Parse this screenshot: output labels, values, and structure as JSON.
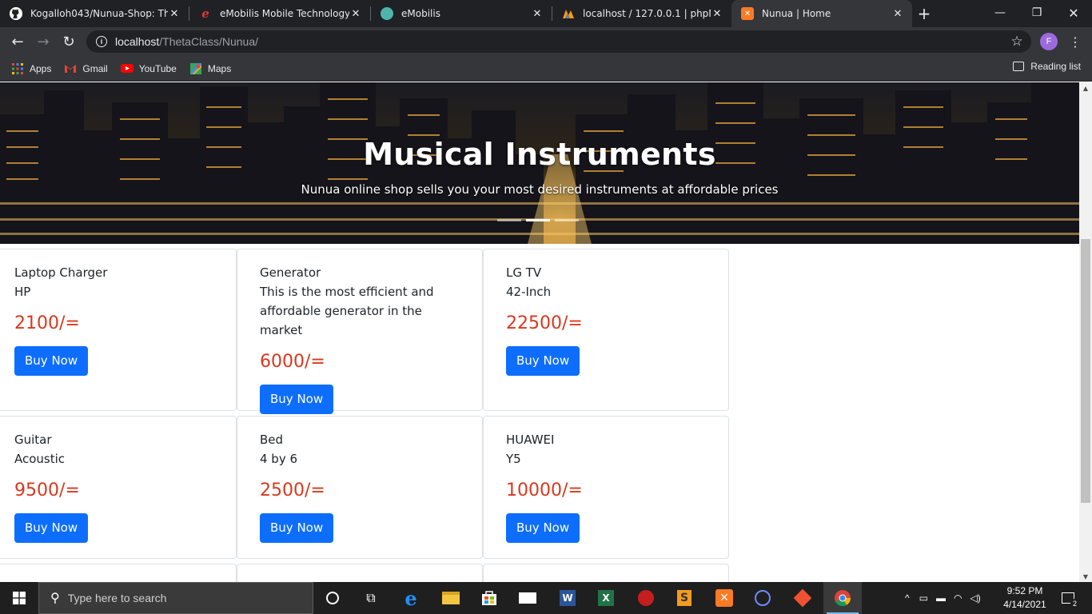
{
  "browser": {
    "tabs": [
      {
        "title": "Kogalloh043/Nunua-Shop: Thi",
        "icon": "github-icon"
      },
      {
        "title": "eMobilis Mobile Technology In",
        "icon": "emobilis-e-icon"
      },
      {
        "title": "eMobilis",
        "icon": "emobilis-globe-icon"
      },
      {
        "title": "localhost / 127.0.0.1 | phpMyA",
        "icon": "phpmyadmin-icon"
      },
      {
        "title": "Nunua | Home",
        "icon": "xampp-icon"
      }
    ],
    "address": {
      "host": "localhost",
      "path": "/ThetaClass/Nunua/"
    },
    "profile_initial": "F",
    "bookmarks": [
      {
        "label": "Apps",
        "icon": "apps-grid-icon"
      },
      {
        "label": "Gmail",
        "icon": "gmail-icon"
      },
      {
        "label": "YouTube",
        "icon": "youtube-icon"
      },
      {
        "label": "Maps",
        "icon": "maps-icon"
      }
    ],
    "reading_list": "Reading list"
  },
  "hero": {
    "title": "Musical Instruments",
    "subtitle": "Nunua online shop sells you your most desired instruments at affordable prices",
    "active_slide": 2,
    "slide_count": 3
  },
  "products": [
    {
      "name": "Laptop Charger",
      "desc": "HP",
      "price": "2100/=",
      "button": "Buy Now"
    },
    {
      "name": "Generator",
      "desc": "This is the most efficient and affordable generator in the market",
      "price": "6000/=",
      "button": "Buy Now"
    },
    {
      "name": "LG TV",
      "desc": "42-Inch",
      "price": "22500/=",
      "button": "Buy Now"
    },
    {
      "name": "Guitar",
      "desc": "Acoustic",
      "price": "9500/=",
      "button": "Buy Now"
    },
    {
      "name": "Bed",
      "desc": "4 by 6",
      "price": "2500/=",
      "button": "Buy Now"
    },
    {
      "name": "HUAWEI",
      "desc": "Y5",
      "price": "10000/=",
      "button": "Buy Now"
    }
  ],
  "taskbar": {
    "search_placeholder": "Type here to search",
    "time": "9:52 PM",
    "date": "4/14/2021",
    "notifications": "2"
  }
}
